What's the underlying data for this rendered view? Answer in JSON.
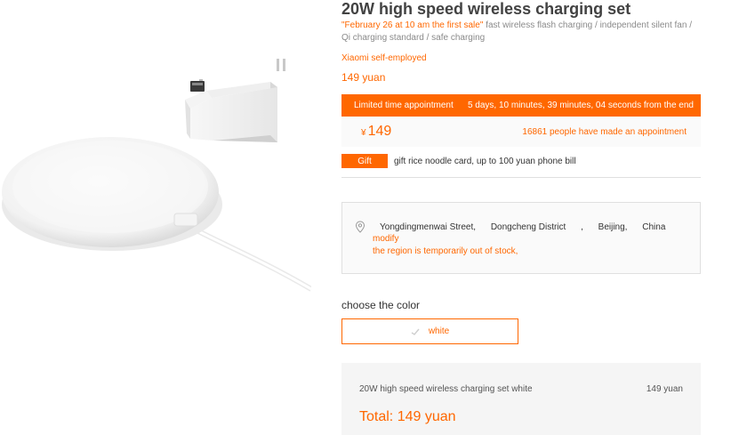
{
  "product": {
    "title": "20W high speed wireless charging set",
    "desc_highlight": "\"February 26 at 10 am the first sale\"",
    "desc_rest": " fast wireless flash charging / independent silent fan / Qi charging standard / safe charging",
    "seller": "Xiaomi self-employed",
    "price": "149 yuan"
  },
  "promo": {
    "label": "Limited time appointment",
    "countdown": "5 days, 10 minutes, 39 minutes, 04 seconds from the end",
    "currency": "¥",
    "price": "149",
    "appointments": "16861 people have made an appointment"
  },
  "gift": {
    "badge": "Gift",
    "text": "gift rice noodle card, up to 100 yuan phone bill"
  },
  "address": {
    "street": "Yongdingmenwai Street,",
    "district": "Dongcheng District",
    "sep": ",",
    "city": "Beijing,",
    "country": "China",
    "modify": "modify",
    "stock_note": "the region is temporarily out of stock,"
  },
  "color": {
    "label": "choose the color",
    "option": "white"
  },
  "summary": {
    "item": "20W high speed wireless charging set white",
    "item_price": "149 yuan",
    "total": "Total: 149 yuan"
  },
  "icons": [
    "location-pin-icon",
    "color-check-icon"
  ],
  "colors": {
    "accent": "#ff6700",
    "panel": "#fafafa"
  }
}
